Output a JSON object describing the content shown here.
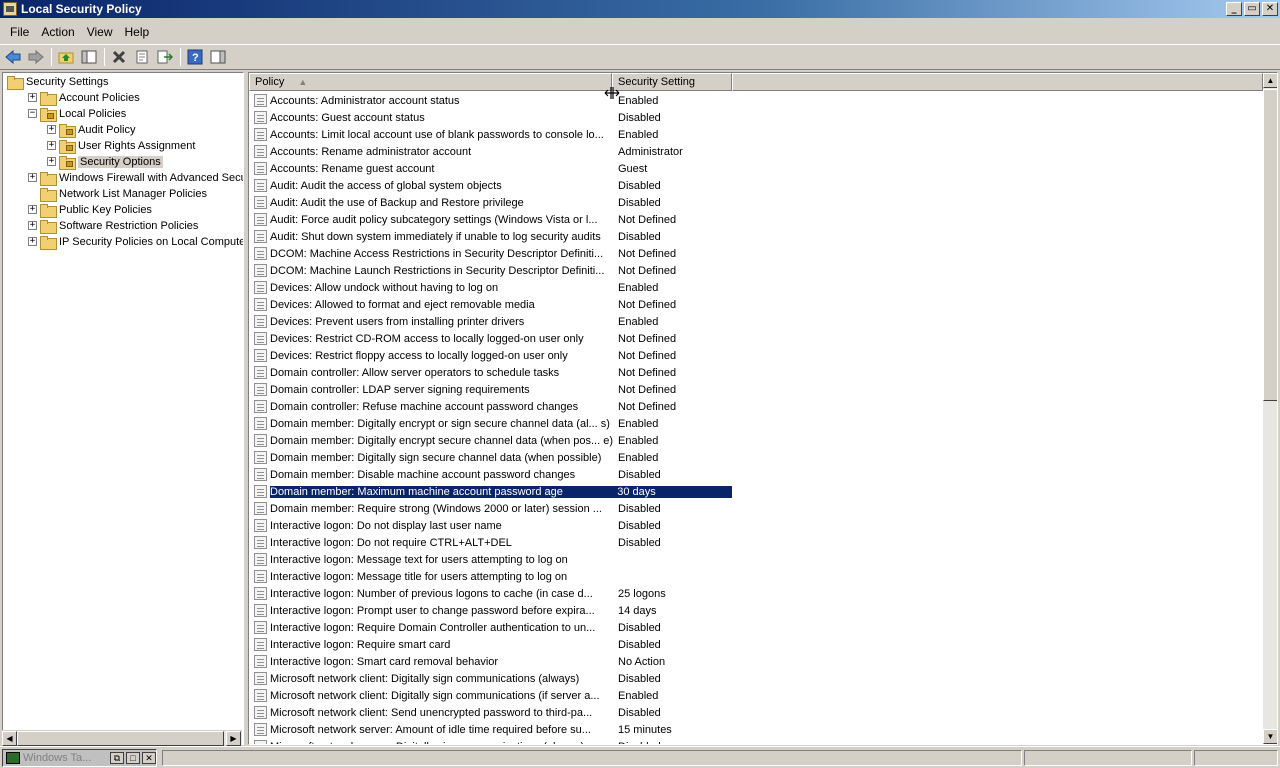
{
  "window": {
    "title": "Local Security Policy",
    "min": "_",
    "max": "▭",
    "close": "✕"
  },
  "menu": [
    "File",
    "Action",
    "View",
    "Help"
  ],
  "tree": [
    {
      "label": "Security Settings",
      "level": 0,
      "exp": ""
    },
    {
      "label": "Account Policies",
      "level": 1,
      "exp": "+"
    },
    {
      "label": "Local Policies",
      "level": 1,
      "exp": "−"
    },
    {
      "label": "Audit Policy",
      "level": 2,
      "exp": "+"
    },
    {
      "label": "User Rights Assignment",
      "level": 2,
      "exp": "+"
    },
    {
      "label": "Security Options",
      "level": 2,
      "exp": "+",
      "selected": true
    },
    {
      "label": "Windows Firewall with Advanced Security",
      "level": 1,
      "exp": "+"
    },
    {
      "label": "Network List Manager Policies",
      "level": 1,
      "exp": ""
    },
    {
      "label": "Public Key Policies",
      "level": 1,
      "exp": "+"
    },
    {
      "label": "Software Restriction Policies",
      "level": 1,
      "exp": "+"
    },
    {
      "label": "IP Security Policies on Local Computer",
      "level": 1,
      "exp": "+"
    }
  ],
  "columns": {
    "policy": "Policy",
    "setting": "Security Setting"
  },
  "rows": [
    [
      "Accounts: Administrator account status",
      "Enabled"
    ],
    [
      "Accounts: Guest account status",
      "Disabled"
    ],
    [
      "Accounts: Limit local account use of blank passwords to console lo...",
      "Enabled"
    ],
    [
      "Accounts: Rename administrator account",
      "Administrator"
    ],
    [
      "Accounts: Rename guest account",
      "Guest"
    ],
    [
      "Audit: Audit the access of global system objects",
      "Disabled"
    ],
    [
      "Audit: Audit the use of Backup and Restore privilege",
      "Disabled"
    ],
    [
      "Audit: Force audit policy subcategory settings (Windows Vista or l...",
      "Not Defined"
    ],
    [
      "Audit: Shut down system immediately if unable to log security audits",
      "Disabled"
    ],
    [
      "DCOM: Machine Access Restrictions in Security Descriptor Definiti...",
      "Not Defined"
    ],
    [
      "DCOM: Machine Launch Restrictions in Security Descriptor Definiti...",
      "Not Defined"
    ],
    [
      "Devices: Allow undock without having to log on",
      "Enabled"
    ],
    [
      "Devices: Allowed to format and eject removable media",
      "Not Defined"
    ],
    [
      "Devices: Prevent users from installing printer drivers",
      "Enabled"
    ],
    [
      "Devices: Restrict CD-ROM access to locally logged-on user only",
      "Not Defined"
    ],
    [
      "Devices: Restrict floppy access to locally logged-on user only",
      "Not Defined"
    ],
    [
      "Domain controller: Allow server operators to schedule tasks",
      "Not Defined"
    ],
    [
      "Domain controller: LDAP server signing requirements",
      "Not Defined"
    ],
    [
      "Domain controller: Refuse machine account password changes",
      "Not Defined"
    ],
    [
      "Domain member: Digitally encrypt or sign secure channel data (al... s)",
      "Enabled"
    ],
    [
      "Domain member: Digitally encrypt secure channel data (when pos... e)",
      "Enabled"
    ],
    [
      "Domain member: Digitally sign secure channel data (when possible)",
      "Enabled"
    ],
    [
      "Domain member: Disable machine account password changes",
      "Disabled"
    ],
    [
      "Domain member: Maximum machine account password age",
      "30 days"
    ],
    [
      "Domain member: Require strong (Windows 2000 or later) session ...",
      "Disabled"
    ],
    [
      "Interactive logon: Do not display last user name",
      "Disabled"
    ],
    [
      "Interactive logon: Do not require CTRL+ALT+DEL",
      "Disabled"
    ],
    [
      "Interactive logon: Message text for users attempting to log on",
      ""
    ],
    [
      "Interactive logon: Message title for users attempting to log on",
      ""
    ],
    [
      "Interactive logon: Number of previous logons to cache (in case d...",
      "25 logons"
    ],
    [
      "Interactive logon: Prompt user to change password before expira...",
      "14 days"
    ],
    [
      "Interactive logon: Require Domain Controller authentication to un...",
      "Disabled"
    ],
    [
      "Interactive logon: Require smart card",
      "Disabled"
    ],
    [
      "Interactive logon: Smart card removal behavior",
      "No Action"
    ],
    [
      "Microsoft network client: Digitally sign communications (always)",
      "Disabled"
    ],
    [
      "Microsoft network client: Digitally sign communications (if server a...",
      "Enabled"
    ],
    [
      "Microsoft network client: Send unencrypted password to third-pa...",
      "Disabled"
    ],
    [
      "Microsoft network server: Amount of idle time required before su...",
      "15 minutes"
    ],
    [
      "Microsoft network server: Digitally sign communications (always)",
      "Disabled"
    ]
  ],
  "selected_row": 23,
  "taskbar": {
    "label": "Windows Ta..."
  },
  "colors": {
    "title_start": "#0a246a",
    "selection": "#0a246a",
    "face": "#d4d0c8"
  }
}
